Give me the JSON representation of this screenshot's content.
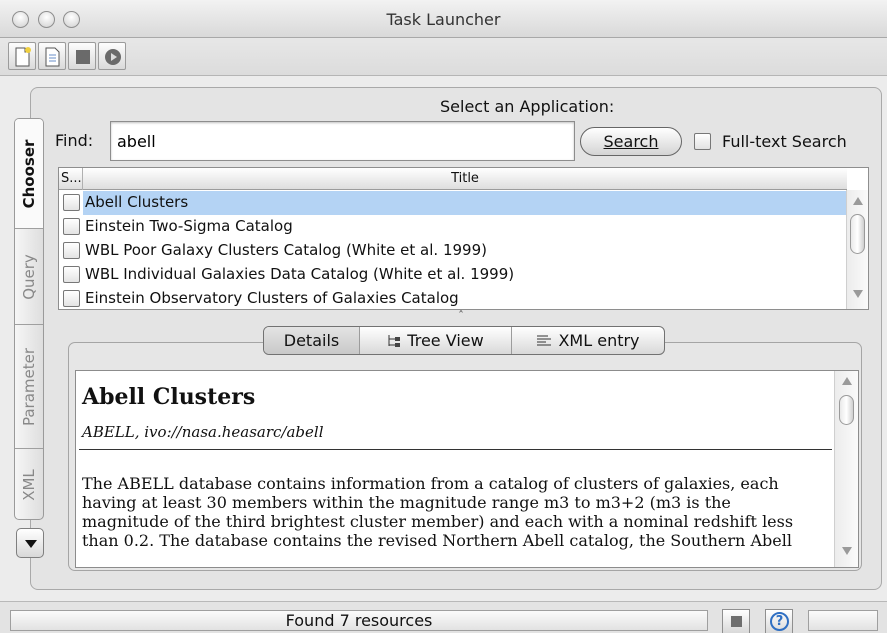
{
  "window": {
    "title": "Task Launcher"
  },
  "toolbar": {
    "buttons": [
      {
        "icon": "new-document-icon"
      },
      {
        "icon": "document-icon"
      },
      {
        "icon": "stop-square-icon"
      },
      {
        "icon": "play-circle-icon"
      }
    ]
  },
  "chooser": {
    "heading": "Select an Application:",
    "find_label": "Find:",
    "find_value": "abell",
    "search_label": "Search",
    "fulltext_label": "Full-text Search",
    "fulltext_checked": false
  },
  "side_tabs": [
    {
      "label": "Chooser",
      "active": true
    },
    {
      "label": "Query",
      "active": false
    },
    {
      "label": "Parameter",
      "active": false
    },
    {
      "label": "XML",
      "active": false
    }
  ],
  "results": {
    "columns": [
      "S...",
      "Title"
    ],
    "rows": [
      {
        "title": "Abell Clusters",
        "selected": true,
        "checked": false
      },
      {
        "title": "Einstein Two-Sigma Catalog",
        "selected": false,
        "checked": false
      },
      {
        "title": "WBL Poor Galaxy Clusters Catalog (White et al. 1999)",
        "selected": false,
        "checked": false
      },
      {
        "title": "WBL Individual Galaxies Data Catalog (White et al. 1999)",
        "selected": false,
        "checked": false
      },
      {
        "title": "Einstein Observatory Clusters of Galaxies Catalog",
        "selected": false,
        "checked": false
      }
    ]
  },
  "detail_tabs": [
    {
      "label": "Details",
      "active": true,
      "icon": ""
    },
    {
      "label": "Tree View",
      "active": false,
      "icon": "tree-icon"
    },
    {
      "label": "XML entry",
      "active": false,
      "icon": "lines-icon"
    }
  ],
  "details": {
    "title": "Abell Clusters",
    "identifier": "ABELL, ivo://nasa.heasarc/abell",
    "description": "The ABELL database contains information from a catalog of clusters of galaxies, each having at least 30 members within the magnitude range m3 to m3+2 (m3 is the magnitude of the third brightest cluster member) and each with a nominal redshift less than 0.2. The database contains the revised Northern Abell catalog, the Southern Abell"
  },
  "status": {
    "message": "Found 7 resources",
    "help_glyph": "?"
  },
  "colors": {
    "selection": "#b4d3f4",
    "help_blue": "#2f6fc3"
  }
}
